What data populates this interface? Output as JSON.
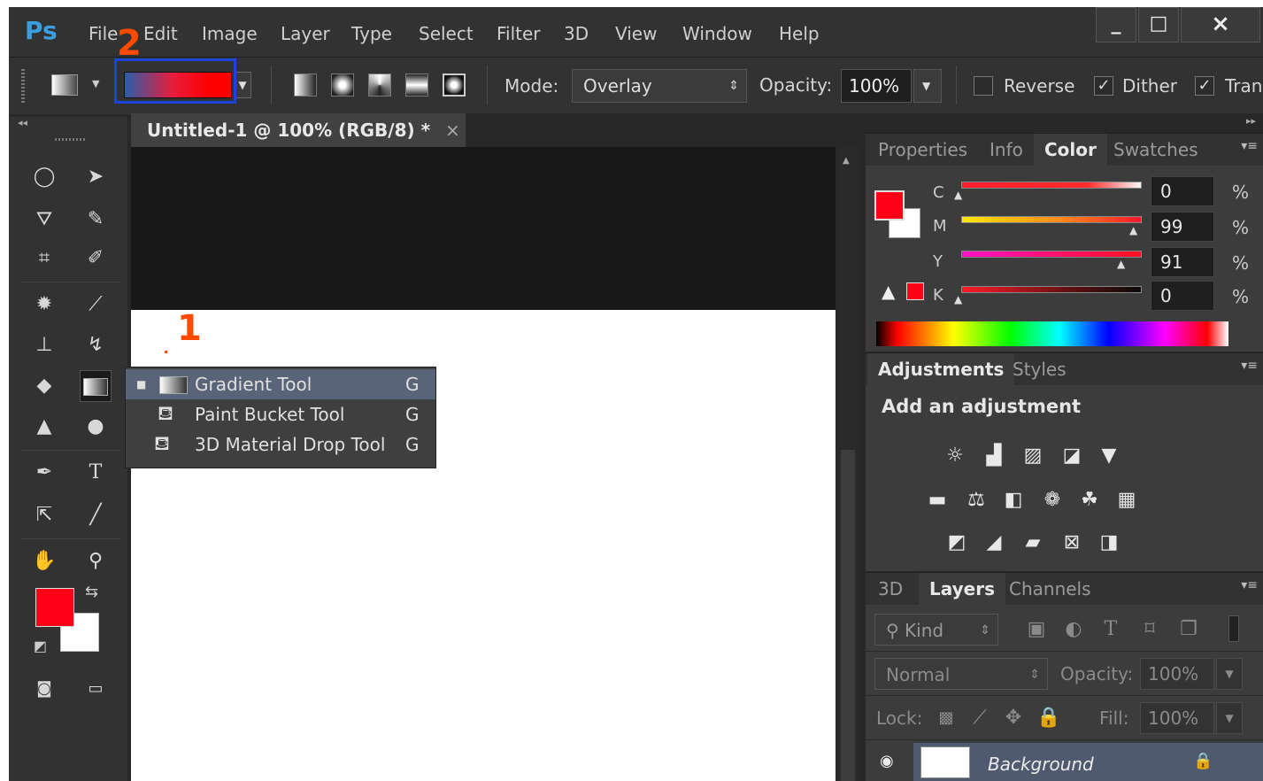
{
  "app": {
    "logo": "Ps"
  },
  "menu": [
    "File",
    "Edit",
    "Image",
    "Layer",
    "Type",
    "Select",
    "Filter",
    "3D",
    "View",
    "Window",
    "Help"
  ],
  "window_controls": {
    "minimize": "_",
    "maximize": "□",
    "close": "×"
  },
  "annotations": {
    "one": "1",
    "two": "2"
  },
  "options_bar": {
    "mode_label": "Mode:",
    "mode_value": "Overlay",
    "opacity_label": "Opacity:",
    "opacity_value": "100%",
    "reverse": {
      "label": "Reverse",
      "checked": false
    },
    "dither": {
      "label": "Dither",
      "checked": true
    },
    "transparency": {
      "label": "Tran",
      "checked": true
    }
  },
  "document": {
    "tab_title": "Untitled-1 @ 100% (RGB/8) *",
    "close": "×"
  },
  "tool_flyout": [
    {
      "label": "Gradient Tool",
      "shortcut": "G",
      "active": true,
      "icon": "gradient-icon"
    },
    {
      "label": "Paint Bucket Tool",
      "shortcut": "G",
      "active": false,
      "icon": "paint-bucket-icon"
    },
    {
      "label": "3D Material Drop Tool",
      "shortcut": "G",
      "active": false,
      "icon": "3d-material-drop-icon"
    }
  ],
  "colors": {
    "foreground": "#ff0018",
    "background": "#ffffff",
    "accent_highlight": "#1d44d8",
    "annotation": "#ff4a00"
  },
  "color_panel": {
    "tabs": [
      "Properties",
      "Info",
      "Color",
      "Swatches"
    ],
    "active_tab": "Color",
    "channels": [
      {
        "name": "C",
        "value": "0",
        "unit": "%"
      },
      {
        "name": "M",
        "value": "99",
        "unit": "%"
      },
      {
        "name": "Y",
        "value": "91",
        "unit": "%"
      },
      {
        "name": "K",
        "value": "0",
        "unit": "%"
      }
    ]
  },
  "adjustments_panel": {
    "tabs": [
      "Adjustments",
      "Styles"
    ],
    "active_tab": "Adjustments",
    "heading": "Add an adjustment"
  },
  "layers_panel": {
    "tabs": [
      "3D",
      "Layers",
      "Channels"
    ],
    "active_tab": "Layers",
    "filter_label": "Kind",
    "blend_mode": "Normal",
    "opacity_label": "Opacity:",
    "opacity_value": "100%",
    "lock_label": "Lock:",
    "fill_label": "Fill:",
    "fill_value": "100%",
    "layers": [
      {
        "name": "Background",
        "visible": true,
        "locked": true
      }
    ]
  }
}
